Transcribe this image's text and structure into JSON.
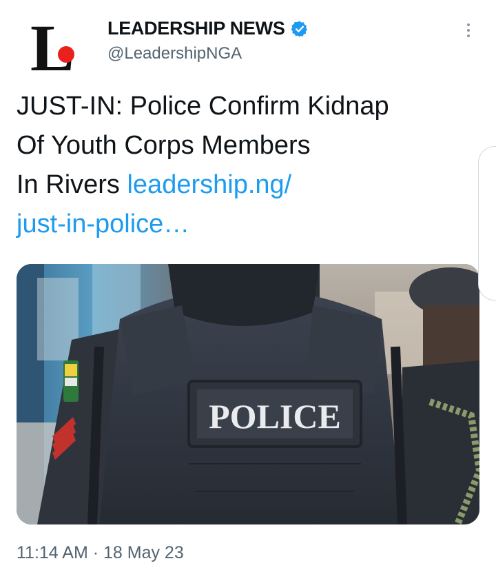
{
  "author": {
    "display_name": "LEADERSHIP NEWS",
    "handle": "@LeadershipNGA",
    "verified_icon": "verified-badge-icon",
    "logo_letter": "L",
    "logo_color": "#e8211d"
  },
  "tweet": {
    "text_before": "JUST-IN: Police Confirm Kidnap\nOf Youth Corps Members\nIn Rivers ",
    "link_text": "leadership.ng/\njust-in-police…",
    "image_vest_label": "POLICE",
    "timestamp": "11:14 AM · 18 May 23"
  },
  "colors": {
    "link": "#1d9bf0",
    "verified": "#1d9bf0",
    "secondary_text": "#536471"
  },
  "icons": {
    "more": "more-vertical-icon"
  }
}
